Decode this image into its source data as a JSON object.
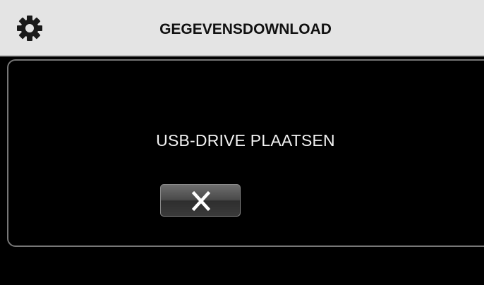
{
  "header": {
    "title": "GEGEVENSDOWNLOAD",
    "settings_icon": "gear-icon"
  },
  "dialog": {
    "message": "USB-DRIVE PLAATSEN",
    "cancel_icon": "close-icon"
  },
  "colors": {
    "header_bg": "#e4e4e4",
    "screen_bg": "#000000",
    "text_light": "#f2f2f2"
  }
}
